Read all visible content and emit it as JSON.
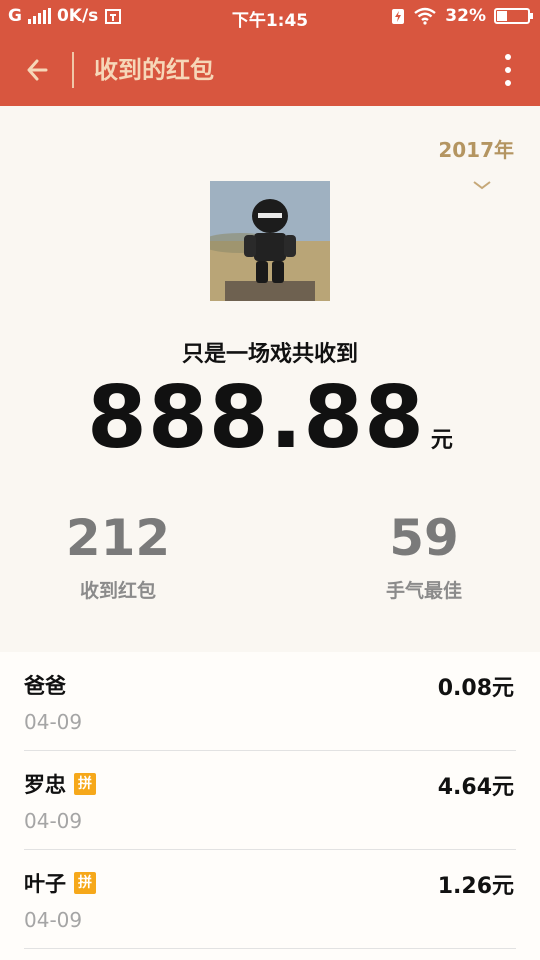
{
  "status_bar": {
    "network": "G",
    "speed": "0K/s",
    "time": "下午1:45",
    "battery": "32%",
    "battery_level": 0.32
  },
  "app_bar": {
    "title": "收到的红包"
  },
  "summary": {
    "year": "2017年",
    "caption": "只是一场戏共收到",
    "amount": "888.88",
    "unit": "元",
    "received_count": "212",
    "received_label": "收到红包",
    "best_luck_count": "59",
    "best_luck_label": "手气最佳"
  },
  "list": [
    {
      "name": "爸爸",
      "date": "04-09",
      "amount": "0.08元",
      "pin_badge": ""
    },
    {
      "name": "罗忠",
      "date": "04-09",
      "amount": "4.64元",
      "pin_badge": "拼"
    },
    {
      "name": "叶子",
      "date": "04-09",
      "amount": "1.26元",
      "pin_badge": "拼"
    }
  ],
  "colors": {
    "header": "#d8563f",
    "accent_gold": "#b49561",
    "badge": "#f6a81a"
  }
}
